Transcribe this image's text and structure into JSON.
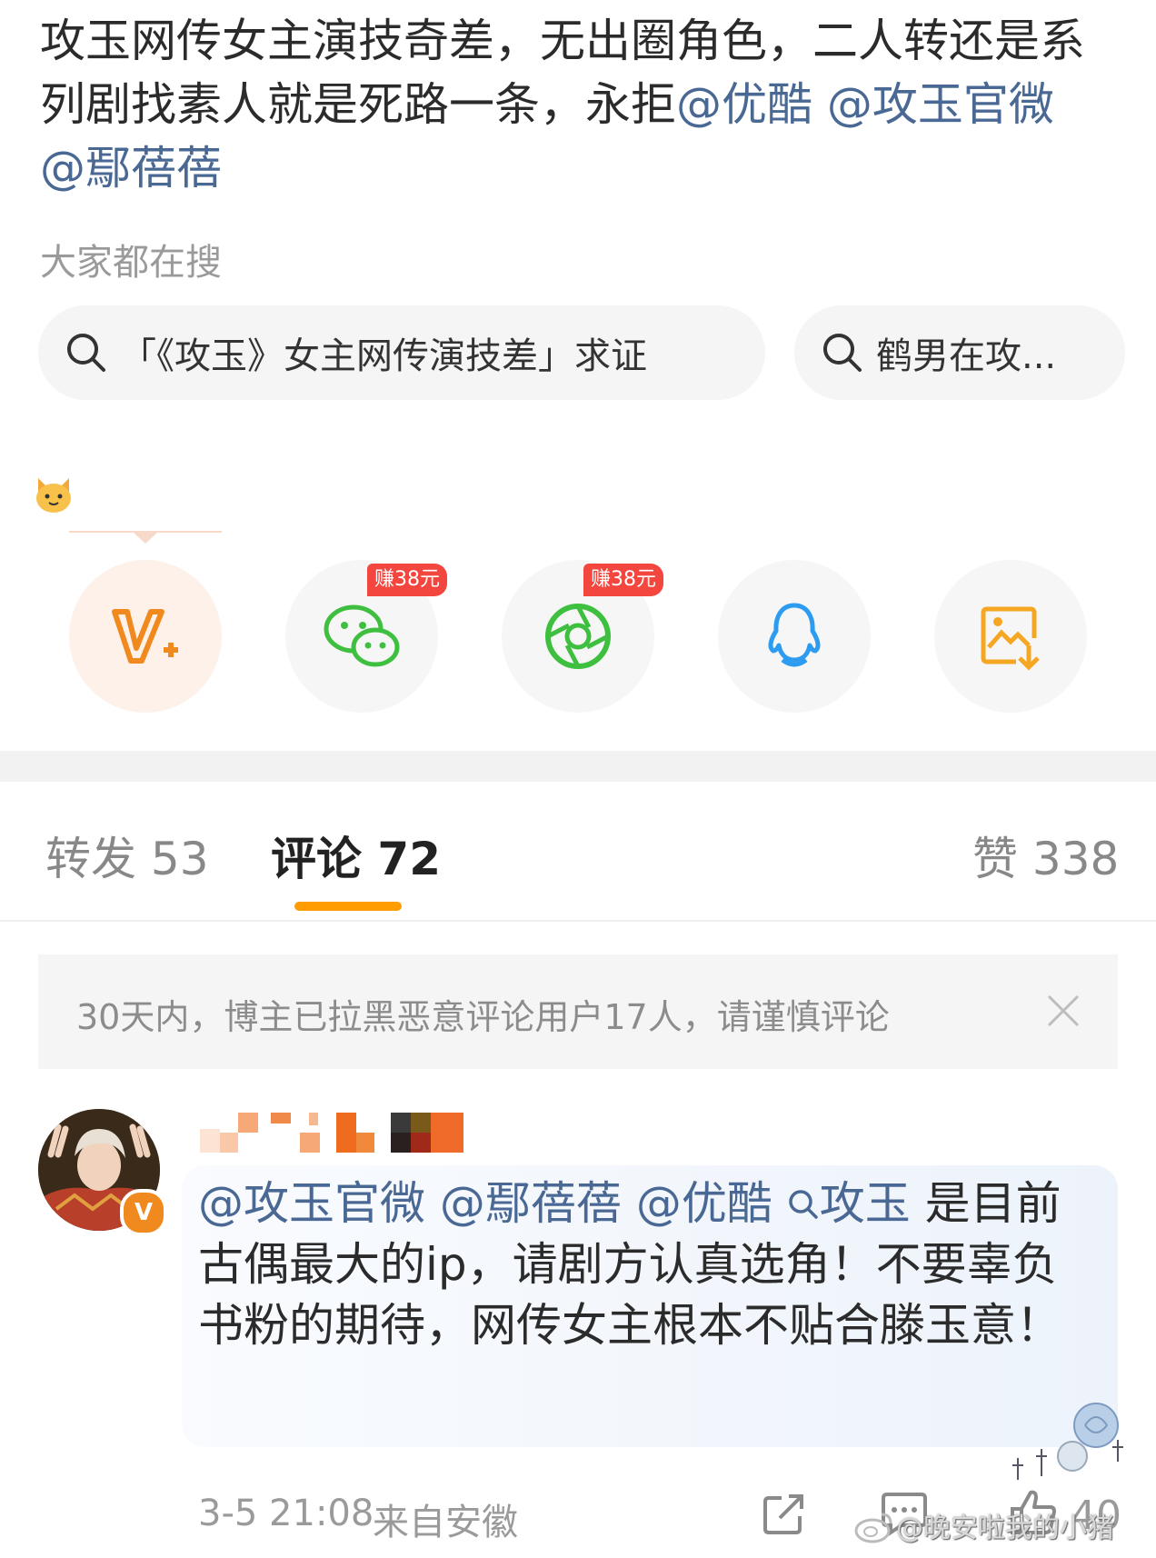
{
  "post": {
    "text_before": "攻玉网传女主演技奇差，无出圈角色，二人转还是系列剧找素人就是死路一条，永拒",
    "mention_1": "@优酷",
    "mention_2": "@攻玉官微",
    "mention_3": "@鄢蓓蓓"
  },
  "search": {
    "heading": "大家都在搜",
    "chip_1": "「《攻玉》女主网传演技差」求证",
    "chip_2": "鹤男在攻..."
  },
  "share": {
    "reward_1": "赚38元",
    "reward_2": "赚38元",
    "icons": [
      "vip-plus-icon",
      "wechat-icon",
      "moments-icon",
      "qq-icon",
      "save-image-icon"
    ]
  },
  "tabs": {
    "repost": "转发 53",
    "comments": "评论 72",
    "likes": "赞 338"
  },
  "notice": {
    "text": "30天内，博主已拉黑恶意评论用户17人，请谨慎评论"
  },
  "comment": {
    "mention_1": "@攻玉官微",
    "mention_2": "@鄢蓓蓓",
    "mention_3": "@优酷",
    "topic": "攻玉",
    "text": "是目前古偶最大的ip，请剧方认真选角！不要辜负书粉的期待，网传女主根本不贴合滕玉意！",
    "time": "3-5 21:08",
    "location": "来自安徽",
    "likes": "40",
    "verified_badge": "V"
  },
  "watermark": "@晚安啦我的小猪",
  "colors": {
    "mention": "#4a6894",
    "tab_underline": "#ff9d00",
    "reward_badge": "#f2463f",
    "vip_orange": "#f08a1f",
    "wechat_green": "#3fbf3f",
    "qq_blue": "#2d9cf0",
    "save_orange": "#f5a623"
  }
}
